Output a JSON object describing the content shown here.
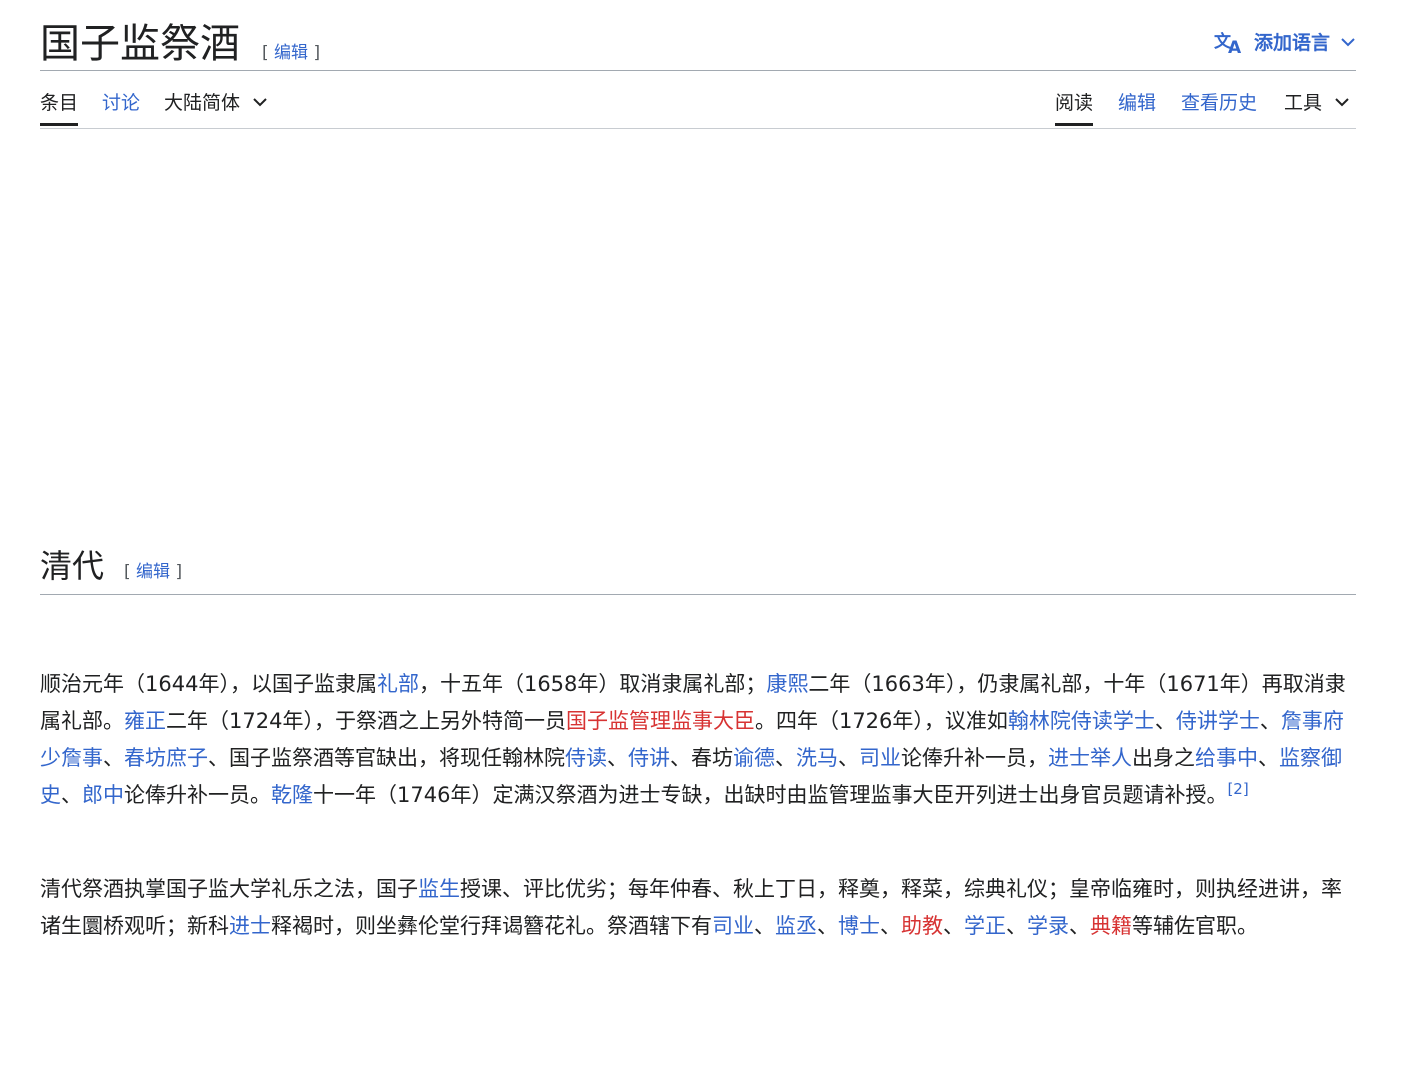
{
  "page": {
    "title": "国子监祭酒",
    "edit_label": "编辑",
    "language_button": "添加语言"
  },
  "tabs": {
    "article": "条目",
    "talk": "讨论",
    "variant": "大陆简体",
    "read": "阅读",
    "edit": "编辑",
    "history": "查看历史",
    "tools": "工具"
  },
  "section": {
    "title": "清代",
    "edit_label": "编辑"
  },
  "colors": {
    "link": "#3366cc",
    "redlink": "#d73333",
    "annotation_underline": "#e8000b"
  }
}
